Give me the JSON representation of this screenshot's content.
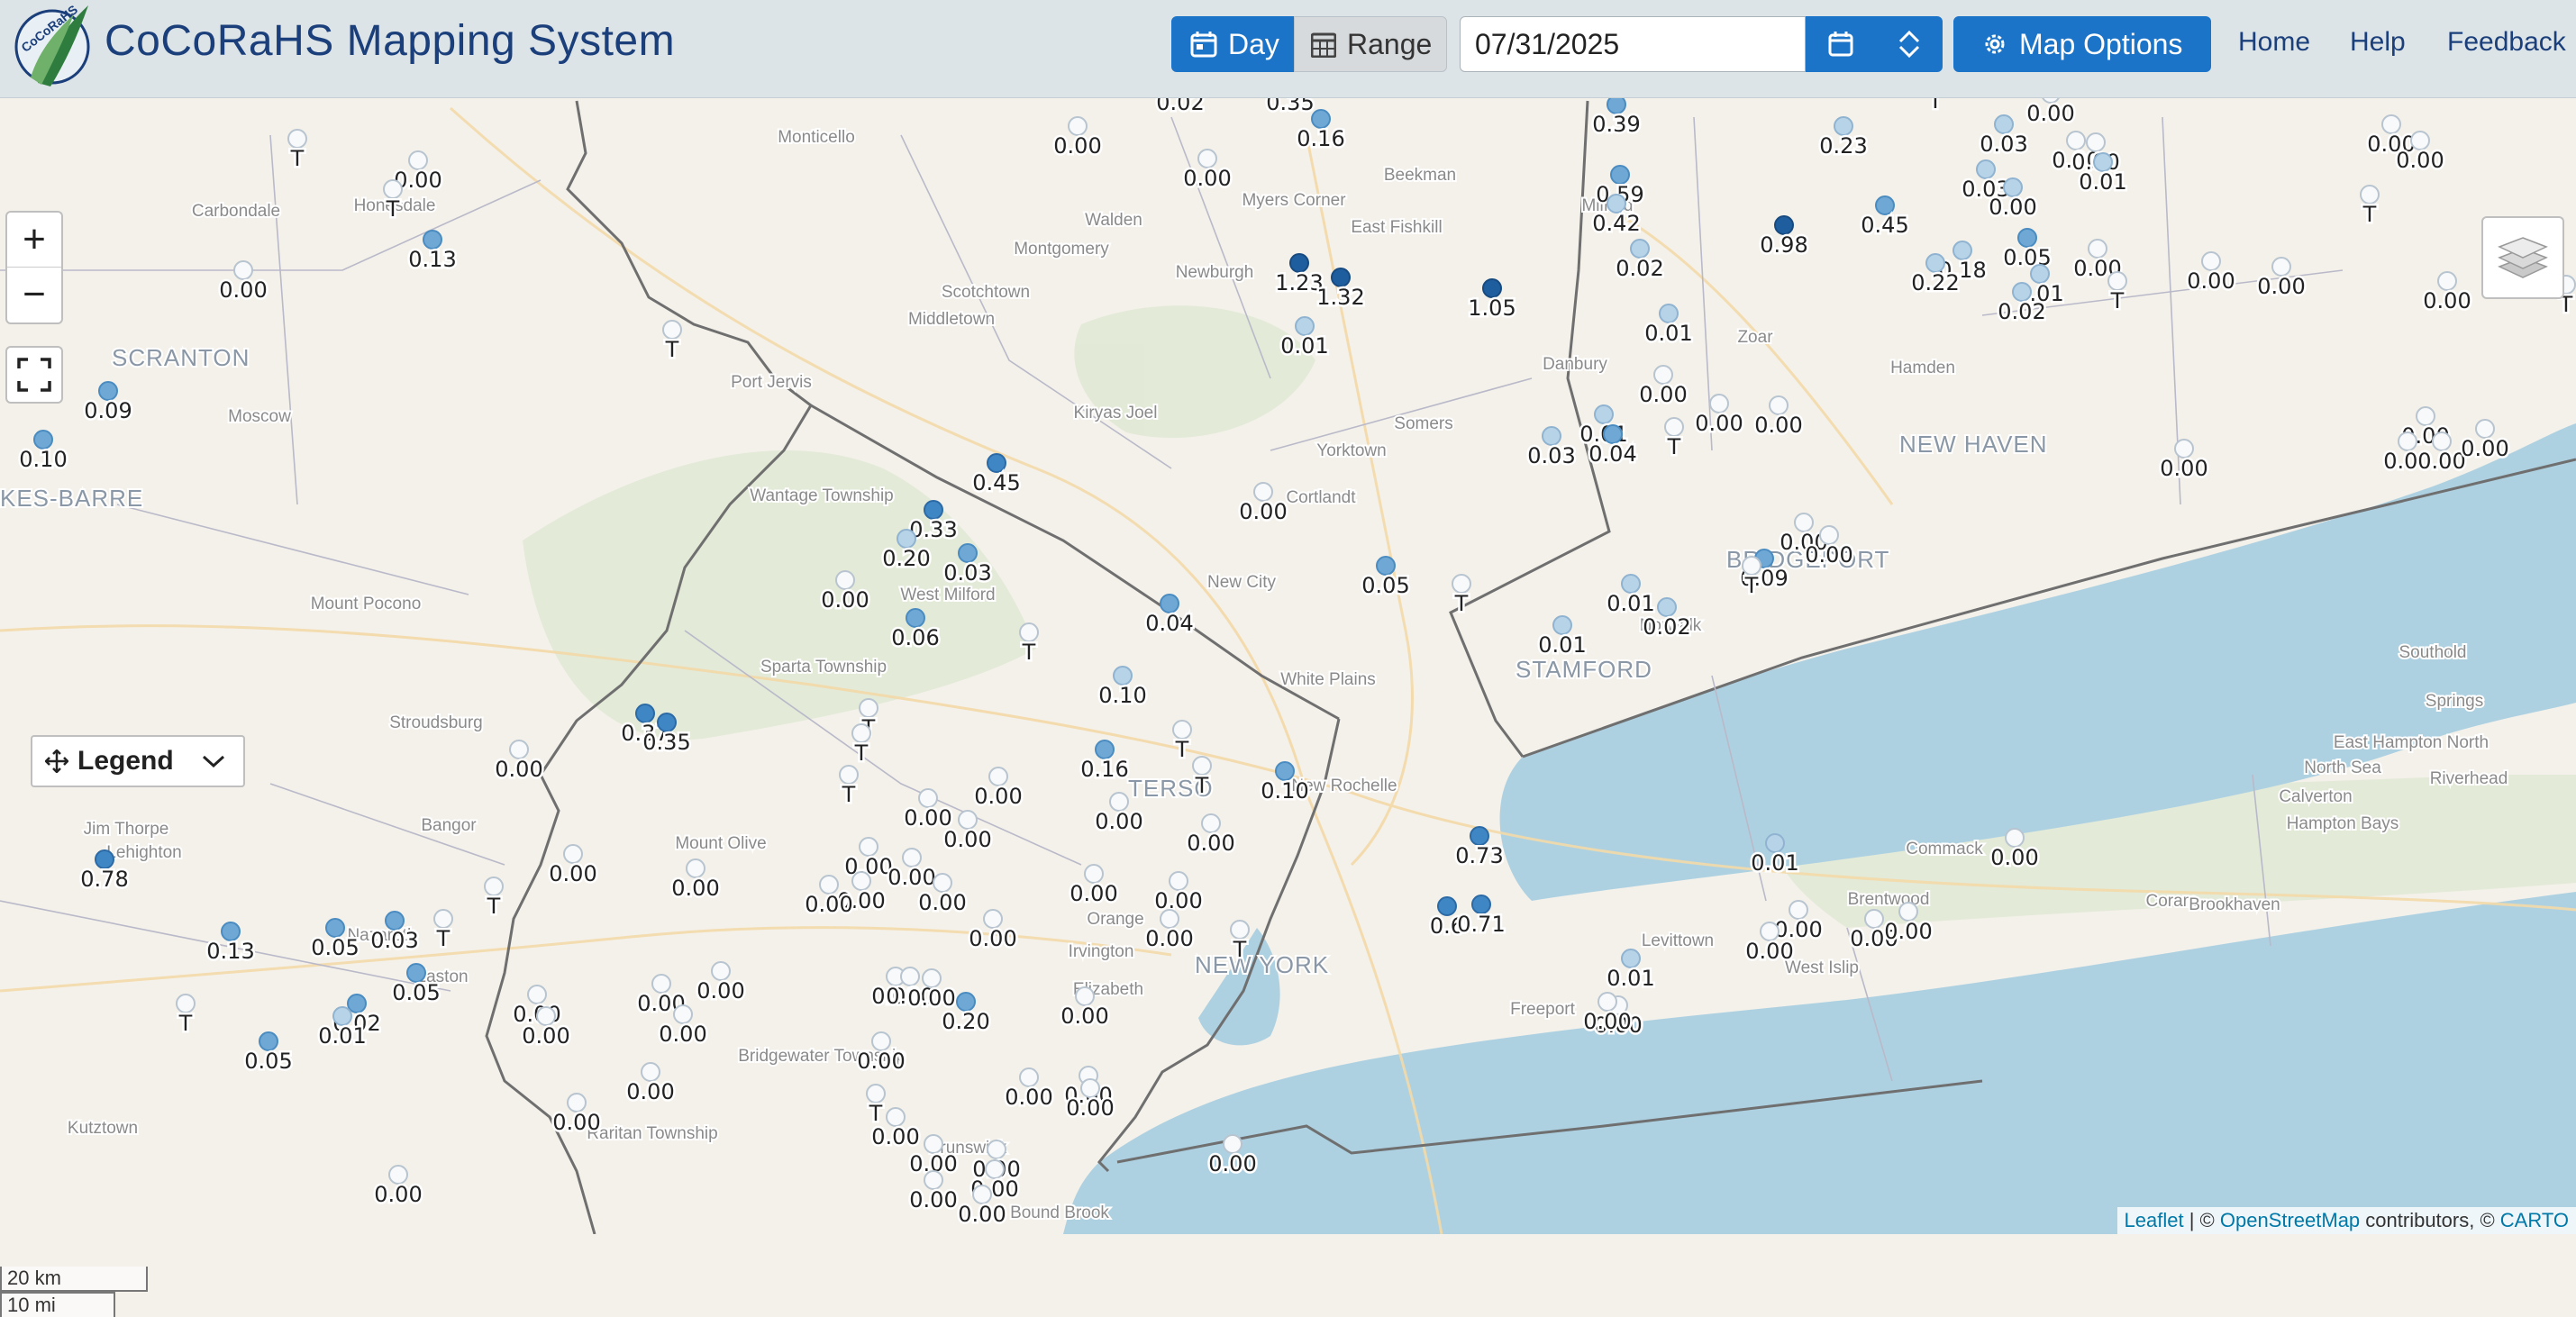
{
  "header": {
    "app_title": "CoCoRaHS Mapping System",
    "logo_text": "CoCoRaHS",
    "day_label": "Day",
    "range_label": "Range",
    "date_value": "07/31/2025",
    "map_options_label": "Map Options",
    "nav": {
      "home": "Home",
      "help": "Help",
      "feedback": "Feedback"
    }
  },
  "map": {
    "legend_label": "Legend",
    "scale": {
      "km": "20 km",
      "mi": "10 mi"
    },
    "attribution": {
      "leaflet": "Leaflet",
      "osm": "OpenStreetMap",
      "carto": "CARTO",
      "sep1": " | © ",
      "sep2": " contributors, © "
    },
    "colors": {
      "water": "#aed1e2",
      "land": "#f4f1ea",
      "dry": "#f7f9fb",
      "light": "#b7d3e8",
      "med": "#6fa8d4",
      "heavy": "#3f86c4",
      "vheavy": "#1f5e9e"
    },
    "regions": [
      "SCRANTON",
      "NEW HAVEN",
      "BRIDGEPORT",
      "STAMFORD",
      "KES-BARRE",
      "NEW YORK",
      "TERSO"
    ],
    "places": [
      "Monticello",
      "Carbondale",
      "Honesdale",
      "Walden",
      "Myers Corner",
      "East Fishkill",
      "Beekman",
      "Milford",
      "Montgomery",
      "Newburgh",
      "Scotchtown",
      "Middletown",
      "Port Jervis",
      "Moscow",
      "Kiryas Joel",
      "Danbury",
      "Zoar",
      "Hamden",
      "Somers",
      "Yorktown",
      "Cortlandt",
      "New City",
      "Wantage Township",
      "Mount Pocono",
      "West Milford",
      "Sparta Township",
      "Stroudsburg",
      "White Plains",
      "Norwalk",
      "Bangor",
      "Jim Thorpe",
      "Lehighton",
      "Mount Olive",
      "New Rochelle",
      "Commack",
      "Brentwood",
      "Coram",
      "Calverton",
      "Riverhead",
      "Southold",
      "Springs",
      "East Hampton North",
      "North Sea",
      "Hampton Bays",
      "Brookhaven",
      "Levittown",
      "Freeport",
      "West Islip",
      "Irvington",
      "Orange",
      "Elizabeth",
      "Bridgewater Township",
      "Raritan Township",
      "Kutztown",
      "Easton",
      "Nazareth",
      "Brunswick",
      "Bound Brook"
    ],
    "stations": [
      [
        "0.02",
        1310,
        112,
        0
      ],
      [
        "0.35",
        1432,
        112,
        0
      ],
      [
        "0.16",
        1466,
        152,
        2
      ],
      [
        "0.00",
        1196,
        160,
        0
      ],
      [
        "0.00",
        1340,
        196,
        0
      ],
      [
        "0.39",
        1794,
        136,
        2
      ],
      [
        "0.59",
        1798,
        214,
        2
      ],
      [
        "0.42",
        1794,
        246,
        1
      ],
      [
        "0.23",
        2046,
        160,
        1
      ],
      [
        "0.03",
        2224,
        158,
        1
      ],
      [
        "0.00",
        2276,
        124,
        0
      ],
      [
        "T",
        2148,
        110,
        0
      ],
      [
        "0.00",
        2304,
        176,
        0
      ],
      [
        "0.00",
        2326,
        178,
        0
      ],
      [
        "0.01",
        2334,
        200,
        1
      ],
      [
        "0.03",
        2204,
        208,
        1
      ],
      [
        "0.00",
        2234,
        228,
        1
      ],
      [
        "0.98",
        1980,
        270,
        4
      ],
      [
        "0.45",
        2092,
        248,
        2
      ],
      [
        "0.05",
        2250,
        284,
        2
      ],
      [
        "0.18",
        2178,
        298,
        1
      ],
      [
        "0.22",
        2148,
        312,
        1
      ],
      [
        "0.01",
        2264,
        324,
        1
      ],
      [
        "0.02",
        2244,
        344,
        1
      ],
      [
        "0.00",
        2328,
        296,
        0
      ],
      [
        "T",
        2350,
        332,
        0
      ],
      [
        "0.00",
        2454,
        310,
        0
      ],
      [
        "0.00",
        2532,
        316,
        0
      ],
      [
        "0.00",
        2716,
        332,
        0
      ],
      [
        "T",
        2630,
        236,
        0
      ],
      [
        "0.00",
        2654,
        158,
        0
      ],
      [
        "0.00",
        2686,
        176,
        0
      ],
      [
        "T",
        2848,
        336,
        0
      ],
      [
        "0.00",
        2692,
        482,
        0
      ],
      [
        "0.00",
        2672,
        510,
        0
      ],
      [
        "0.00",
        2710,
        510,
        0
      ],
      [
        "0.00",
        2758,
        496,
        0
      ],
      [
        "0.00",
        2424,
        518,
        0
      ],
      [
        "0.02",
        1820,
        296,
        1
      ],
      [
        "0.01",
        1852,
        368,
        1
      ],
      [
        "0.00",
        1846,
        436,
        0
      ],
      [
        "0.00",
        1908,
        468,
        0
      ],
      [
        "0.00",
        1974,
        470,
        0
      ],
      [
        "0.01",
        1780,
        480,
        1
      ],
      [
        "0.04",
        1790,
        502,
        2
      ],
      [
        "0.03",
        1722,
        504,
        1
      ],
      [
        "T",
        1858,
        494,
        0
      ],
      [
        "1.23",
        1442,
        312,
        4
      ],
      [
        "1.32",
        1488,
        328,
        4
      ],
      [
        "1.05",
        1656,
        340,
        4
      ],
      [
        "0.01",
        1448,
        382,
        1
      ],
      [
        "0.00",
        1402,
        566,
        0
      ],
      [
        "0.05",
        1538,
        648,
        2
      ],
      [
        "T",
        1622,
        668,
        0
      ],
      [
        "0.00",
        2002,
        600,
        0
      ],
      [
        "0.00",
        2030,
        614,
        0
      ],
      [
        "0.09",
        1958,
        640,
        2
      ],
      [
        "T",
        1944,
        648,
        0
      ],
      [
        "0.01",
        1810,
        668,
        1
      ],
      [
        "0.02",
        1850,
        694,
        1
      ],
      [
        "0.01",
        1734,
        714,
        1
      ],
      [
        "0.13",
        480,
        286,
        2
      ],
      [
        "0.00",
        464,
        198,
        0
      ],
      [
        "T",
        330,
        174,
        0
      ],
      [
        "T",
        436,
        230,
        0
      ],
      [
        "0.00",
        270,
        320,
        0
      ],
      [
        "T",
        746,
        386,
        0
      ],
      [
        "0.09",
        120,
        454,
        2
      ],
      [
        "0.10",
        48,
        508,
        2
      ],
      [
        "0.45",
        1106,
        534,
        3
      ],
      [
        "0.33",
        1036,
        586,
        3
      ],
      [
        "0.20",
        1006,
        618,
        1
      ],
      [
        "0.03",
        1074,
        634,
        2
      ],
      [
        "0.00",
        938,
        664,
        0
      ],
      [
        "0.06",
        1016,
        706,
        2
      ],
      [
        "T",
        1142,
        722,
        0
      ],
      [
        "0.04",
        1298,
        690,
        2
      ],
      [
        "0.10",
        1246,
        770,
        1
      ],
      [
        "0.16",
        1226,
        852,
        2
      ],
      [
        "T",
        1312,
        830,
        0
      ],
      [
        "T",
        1334,
        870,
        0
      ],
      [
        "0.00",
        1344,
        934,
        0
      ],
      [
        "0.10",
        1426,
        876,
        2
      ],
      [
        "0.00",
        1242,
        910,
        0
      ],
      [
        "0.37",
        716,
        812,
        3
      ],
      [
        "0.35",
        740,
        822,
        3
      ],
      [
        "T",
        964,
        806,
        0
      ],
      [
        "T",
        956,
        834,
        0
      ],
      [
        "T",
        942,
        880,
        0
      ],
      [
        "0.00",
        1030,
        906,
        0
      ],
      [
        "0.00",
        1108,
        882,
        0
      ],
      [
        "0.00",
        1074,
        930,
        0
      ],
      [
        "0.00",
        576,
        852,
        0
      ],
      [
        "0.00",
        636,
        968,
        0
      ],
      [
        "0.00",
        772,
        984,
        0
      ],
      [
        "0.00",
        964,
        960,
        0
      ],
      [
        "0.00",
        1012,
        972,
        0
      ],
      [
        "0.00",
        956,
        998,
        0
      ],
      [
        "0.00",
        920,
        1002,
        0
      ],
      [
        "0.00",
        1046,
        1000,
        0
      ],
      [
        "0.00",
        1102,
        1040,
        0
      ],
      [
        "0.00",
        1214,
        990,
        0
      ],
      [
        "0.00",
        1308,
        998,
        0
      ],
      [
        "0.00",
        1298,
        1040,
        0
      ],
      [
        "T",
        1376,
        1052,
        0
      ],
      [
        "0.78",
        116,
        974,
        3
      ],
      [
        "0.13",
        256,
        1054,
        2
      ],
      [
        "0.05",
        372,
        1050,
        2
      ],
      [
        "0.03",
        438,
        1042,
        2
      ],
      [
        "T",
        492,
        1040,
        0
      ],
      [
        "T",
        548,
        1004,
        0
      ],
      [
        "0.05",
        462,
        1100,
        2
      ],
      [
        "0.02",
        396,
        1134,
        2
      ],
      [
        "0.01",
        380,
        1148,
        1
      ],
      [
        "T",
        206,
        1134,
        0
      ],
      [
        "0.05",
        298,
        1176,
        2
      ],
      [
        "0.00",
        596,
        1124,
        0
      ],
      [
        "0.00",
        606,
        1148,
        0
      ],
      [
        "0.00",
        734,
        1112,
        0
      ],
      [
        "0.00",
        758,
        1146,
        0
      ],
      [
        "0.00",
        800,
        1098,
        0
      ],
      [
        "0.00",
        722,
        1210,
        0
      ],
      [
        "0.00",
        640,
        1244,
        0
      ],
      [
        "0.00",
        994,
        1104,
        0
      ],
      [
        "0.00",
        1010,
        1104,
        0
      ],
      [
        "0.00",
        1034,
        1106,
        0
      ],
      [
        "0.20",
        1072,
        1132,
        2
      ],
      [
        "0.00",
        978,
        1176,
        0
      ],
      [
        "0.00",
        1204,
        1126,
        0
      ],
      [
        "0.00",
        1208,
        1214,
        0
      ],
      [
        "0.00",
        1142,
        1216,
        0
      ],
      [
        "0.00",
        1210,
        1228,
        0
      ],
      [
        "T",
        972,
        1234,
        0
      ],
      [
        "0.00",
        994,
        1260,
        0
      ],
      [
        "0.00",
        1036,
        1290,
        0
      ],
      [
        "0.00",
        1106,
        1296,
        0
      ],
      [
        "0.00",
        1104,
        1318,
        0
      ],
      [
        "0.00",
        1036,
        1330,
        0
      ],
      [
        "0.00",
        1090,
        1346,
        0
      ],
      [
        "0.00",
        442,
        1324,
        0
      ],
      [
        "0.73",
        1642,
        948,
        3
      ],
      [
        "0.6",
        1606,
        1026,
        3
      ],
      [
        "0.71",
        1644,
        1024,
        3
      ],
      [
        "0.01",
        1970,
        956,
        1
      ],
      [
        "0.00",
        1996,
        1030,
        0
      ],
      [
        "0.00",
        1964,
        1054,
        0
      ],
      [
        "0.00",
        2080,
        1040,
        0
      ],
      [
        "0.00",
        2118,
        1032,
        0
      ],
      [
        "0.01",
        1810,
        1084,
        1
      ],
      [
        "0.00",
        1796,
        1136,
        0
      ],
      [
        "0.00",
        1784,
        1132,
        0
      ],
      [
        "0.00",
        2236,
        950,
        0
      ],
      [
        "0.00",
        1368,
        1290,
        0
      ]
    ]
  }
}
